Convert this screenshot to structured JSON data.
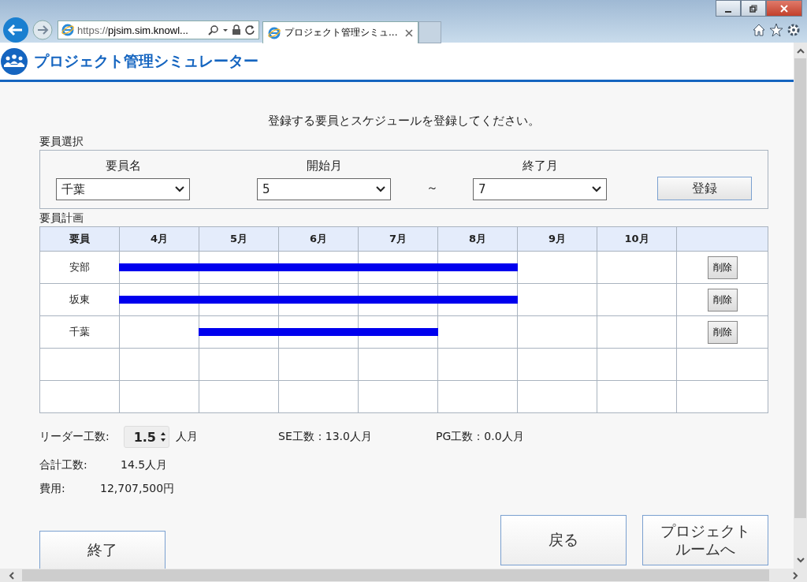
{
  "browser": {
    "address_prefix": "https://",
    "address_host": "pjsim.sim.knowl...",
    "tab_title": "プロジェクト管理シミュ..."
  },
  "app": {
    "title": "プロジェクト管理シミュレーター"
  },
  "instruction": "登録する要員とスケジュールを登録してください。",
  "selection": {
    "heading": "要員選択",
    "fields": [
      {
        "label": "要員名",
        "value": "千葉"
      },
      {
        "label": "開始月",
        "value": "5"
      },
      {
        "label": "終了月",
        "value": "7"
      }
    ],
    "separator": "～",
    "register_button": "登録"
  },
  "plan": {
    "heading": "要員計画",
    "columns": [
      "要員",
      "4月",
      "5月",
      "6月",
      "7月",
      "8月",
      "9月",
      "10月"
    ],
    "rows": [
      {
        "kind": "entry",
        "name": "安部",
        "cells": [
          true,
          true,
          true,
          true,
          true,
          false,
          false
        ],
        "delete_button": "削除"
      },
      {
        "kind": "entry",
        "name": "坂東",
        "cells": [
          true,
          true,
          true,
          true,
          true,
          false,
          false
        ],
        "delete_button": "削除"
      },
      {
        "kind": "entry",
        "name": "千葉",
        "cells": [
          false,
          true,
          true,
          true,
          false,
          false,
          false
        ],
        "delete_button": "削除"
      },
      {
        "kind": "empty"
      },
      {
        "kind": "empty"
      }
    ]
  },
  "summary": {
    "leader_label": "リーダー工数:",
    "leader_value": "1.5",
    "leader_unit": "人月",
    "se": "SE工数：13.0人月",
    "pg": "PG工数：0.0人月",
    "total_label": "合計工数:",
    "total_value": "14.5人月",
    "cost_label": "費用:",
    "cost_value": "12,707,500円"
  },
  "buttons": {
    "finish": "終了",
    "back": "戻る",
    "next": "プロジェクトルームへ"
  }
}
